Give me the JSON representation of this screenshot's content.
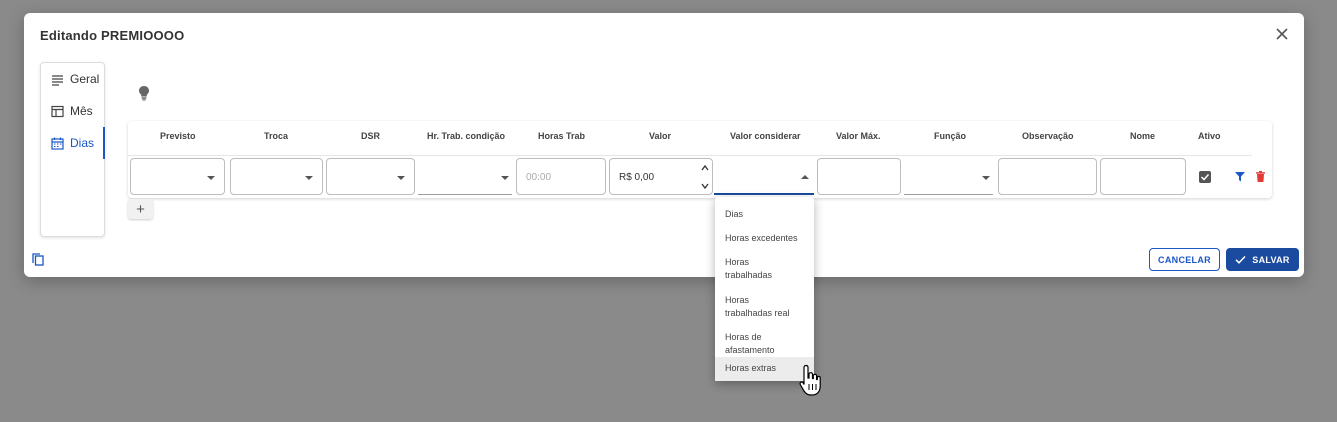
{
  "modal": {
    "title": "Editando PREMIOOOO"
  },
  "side_tabs": [
    {
      "label": "Geral",
      "icon": "lines-icon",
      "active": false
    },
    {
      "label": "Mês",
      "icon": "table-icon",
      "active": false
    },
    {
      "label": "Dias",
      "icon": "calendar-icon",
      "active": true
    }
  ],
  "table": {
    "headers": [
      "Previsto",
      "Troca",
      "DSR",
      "Hr. Trab. condição",
      "Horas Trab",
      "Valor",
      "Valor considerar",
      "Valor Máx.",
      "Função",
      "Observação",
      "Nome",
      "Ativo"
    ],
    "row": {
      "horas_trab_placeholder": "00:00",
      "valor": "R$ 0,00",
      "ativo": true
    }
  },
  "add_button": "+",
  "dropdown": {
    "options": [
      "Dias",
      "Horas excedentes",
      "Horas trabalhadas",
      "Horas trabalhadas real",
      "Horas de afastamento",
      "Horas extras"
    ],
    "hovered": "Horas extras"
  },
  "footer": {
    "cancel_label": "CANCELAR",
    "save_label": "SALVAR"
  },
  "colors": {
    "overlay": "#8a8a8a",
    "primary": "#1a56c4",
    "save_bg": "#1a4b9e",
    "trash": "#e53935"
  }
}
